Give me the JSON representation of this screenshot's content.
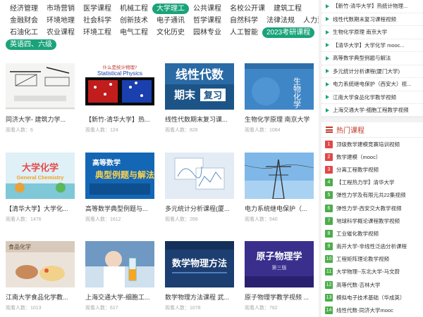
{
  "tags": {
    "row1": [
      "经济管理",
      "市场营销",
      "医学课程",
      "机械工程",
      "大学理工",
      "公共课程",
      "名校公开课",
      "建筑工程"
    ],
    "row2": [
      "金融财会",
      "环境地理",
      "社会科学",
      "创新技术",
      "电子通讯",
      "哲学课程",
      "自然科学",
      "法律法规",
      "人力资源"
    ],
    "row3": [
      "石油化工",
      "农业课程",
      "环境工程",
      "电气工程",
      "文化历史",
      "园林专业",
      "人工智能",
      "2023考研课程"
    ],
    "row4": [
      "英语四、六级"
    ],
    "active": [
      "大学理工",
      "2023考研课程",
      "英语四、六级"
    ]
  },
  "views_label": "观看人数：",
  "courses": [
    {
      "title": "同济大学- 建筑力学...",
      "views": "6"
    },
    {
      "title": "【新竹-清华大学】热...",
      "views": "124"
    },
    {
      "title": "线性代数期末复习课...",
      "views": "828"
    },
    {
      "title": "生物化学原理 南京大学",
      "views": "1084"
    },
    {
      "title": "【清华大学】大学化...",
      "views": "1476"
    },
    {
      "title": "高等数学典型例题与...",
      "views": "1612"
    },
    {
      "title": "多元统计分析课程(厦...",
      "views": "268"
    },
    {
      "title": "电力系统继电保护（...",
      "views": "540"
    },
    {
      "title": "江南大学食品化学教...",
      "views": "1013"
    },
    {
      "title": "上海交通大学-细胞工...",
      "views": "617"
    },
    {
      "title": "数学物理方法课程 武...",
      "views": "1078"
    },
    {
      "title": "原子物理学教学视频 ...",
      "views": "782"
    }
  ],
  "thumb_text": {
    "t2_q": "什么是统计物理?",
    "t2_en": "Statistical Physics",
    "t3_a": "线性代数",
    "t3_b": "期末",
    "t3_c": "复习",
    "t4": "生物化学",
    "t5_a": "大学化学",
    "t5_b": "General Chemistry",
    "t6_a": "高等数学",
    "t6_b": "典型例题与解法",
    "t9": "食品化学",
    "t11": "数学物理方法",
    "t12_a": "原子物理学",
    "t12_b": "第三版"
  },
  "sidebar_list": [
    "【新竹-清华大学】热统计物理...",
    "线性代数期末复习课程视频",
    "生物化学原理 南京大学",
    "【清华大学】大学化学 mooc...",
    "高等数学典型例题与解法",
    "多元统计分析课程(厦门大学)",
    "电力系统继电保护（西安大）视...",
    "江南大学食品化学教学视频",
    "上海交通大学-细胞工程教学视频"
  ],
  "hot": {
    "title": "热门课程",
    "items": [
      {
        "n": "1",
        "text": "顶级数学建模竞赛培训视频"
      },
      {
        "n": "2",
        "text": "数学建模（mooc）"
      },
      {
        "n": "3",
        "text": "分离工程教学视频"
      },
      {
        "n": "4",
        "text": "【工程热力学】清华大学"
      },
      {
        "n": "5",
        "text": "弹性力学及有限元共22集视频"
      },
      {
        "n": "6",
        "text": "弹性力学-西安交大教学视频"
      },
      {
        "n": "7",
        "text": "地球科学概论课程教学视频"
      },
      {
        "n": "8",
        "text": "工业催化教学视频"
      },
      {
        "n": "9",
        "text": "南开大学-非线性泛函分析课程"
      },
      {
        "n": "10",
        "text": "工程矩阵理论教学视频"
      },
      {
        "n": "11",
        "text": "大学物理--东北大学-马文蔚"
      },
      {
        "n": "12",
        "text": "高等代数-吉林大学"
      },
      {
        "n": "13",
        "text": "模拟电子技术基础（华成英）"
      },
      {
        "n": "14",
        "text": "线性代数-同济大学mooc"
      }
    ]
  },
  "colors": {
    "accent": "#1aa37a",
    "hot_red": "#e04848",
    "hot_green": "#4cae4c"
  }
}
